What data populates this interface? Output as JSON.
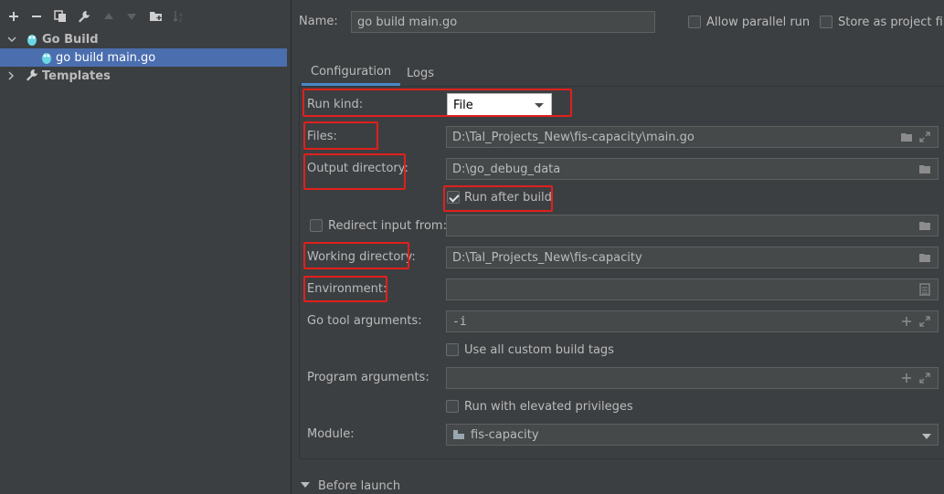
{
  "colors": {
    "background": "#3c3f41",
    "selection": "#4b6eaf",
    "field_bg": "#45494a",
    "highlight": "#e0201c",
    "accent": "#4a88c7"
  },
  "toolbar": {
    "icons": [
      "plus-icon",
      "minus-icon",
      "copy-icon",
      "wrench-icon",
      "arrow-up-icon",
      "arrow-down-icon",
      "folder-add-icon",
      "sort-icon"
    ]
  },
  "tree": {
    "go_build": "Go Build",
    "go_build_main": "go build main.go",
    "templates": "Templates"
  },
  "header": {
    "name_label": "Name:",
    "name_value": "go build main.go",
    "allow_parallel": "Allow parallel run",
    "store_as_project": "Store as project file"
  },
  "tabs": [
    "Configuration",
    "Logs"
  ],
  "form": {
    "run_kind_label": "Run kind:",
    "run_kind_value": "File",
    "files_label": "Files:",
    "files_value": "D:\\Tal_Projects_New\\fis-capacity\\main.go",
    "output_dir_label": "Output directory:",
    "output_dir_value": "D:\\go_debug_data",
    "run_after_build": "Run after build",
    "redirect_input": "Redirect input from:",
    "working_dir_label": "Working directory:",
    "working_dir_value": "D:\\Tal_Projects_New\\fis-capacity",
    "environment_label": "Environment:",
    "go_tool_args_label": "Go tool arguments:",
    "go_tool_args_value": "-i",
    "use_custom_build_tags": "Use all custom build tags",
    "program_args_label": "Program arguments:",
    "run_elevated": "Run with elevated privileges",
    "module_label": "Module:",
    "module_value": "fis-capacity"
  },
  "before_launch": "Before launch"
}
